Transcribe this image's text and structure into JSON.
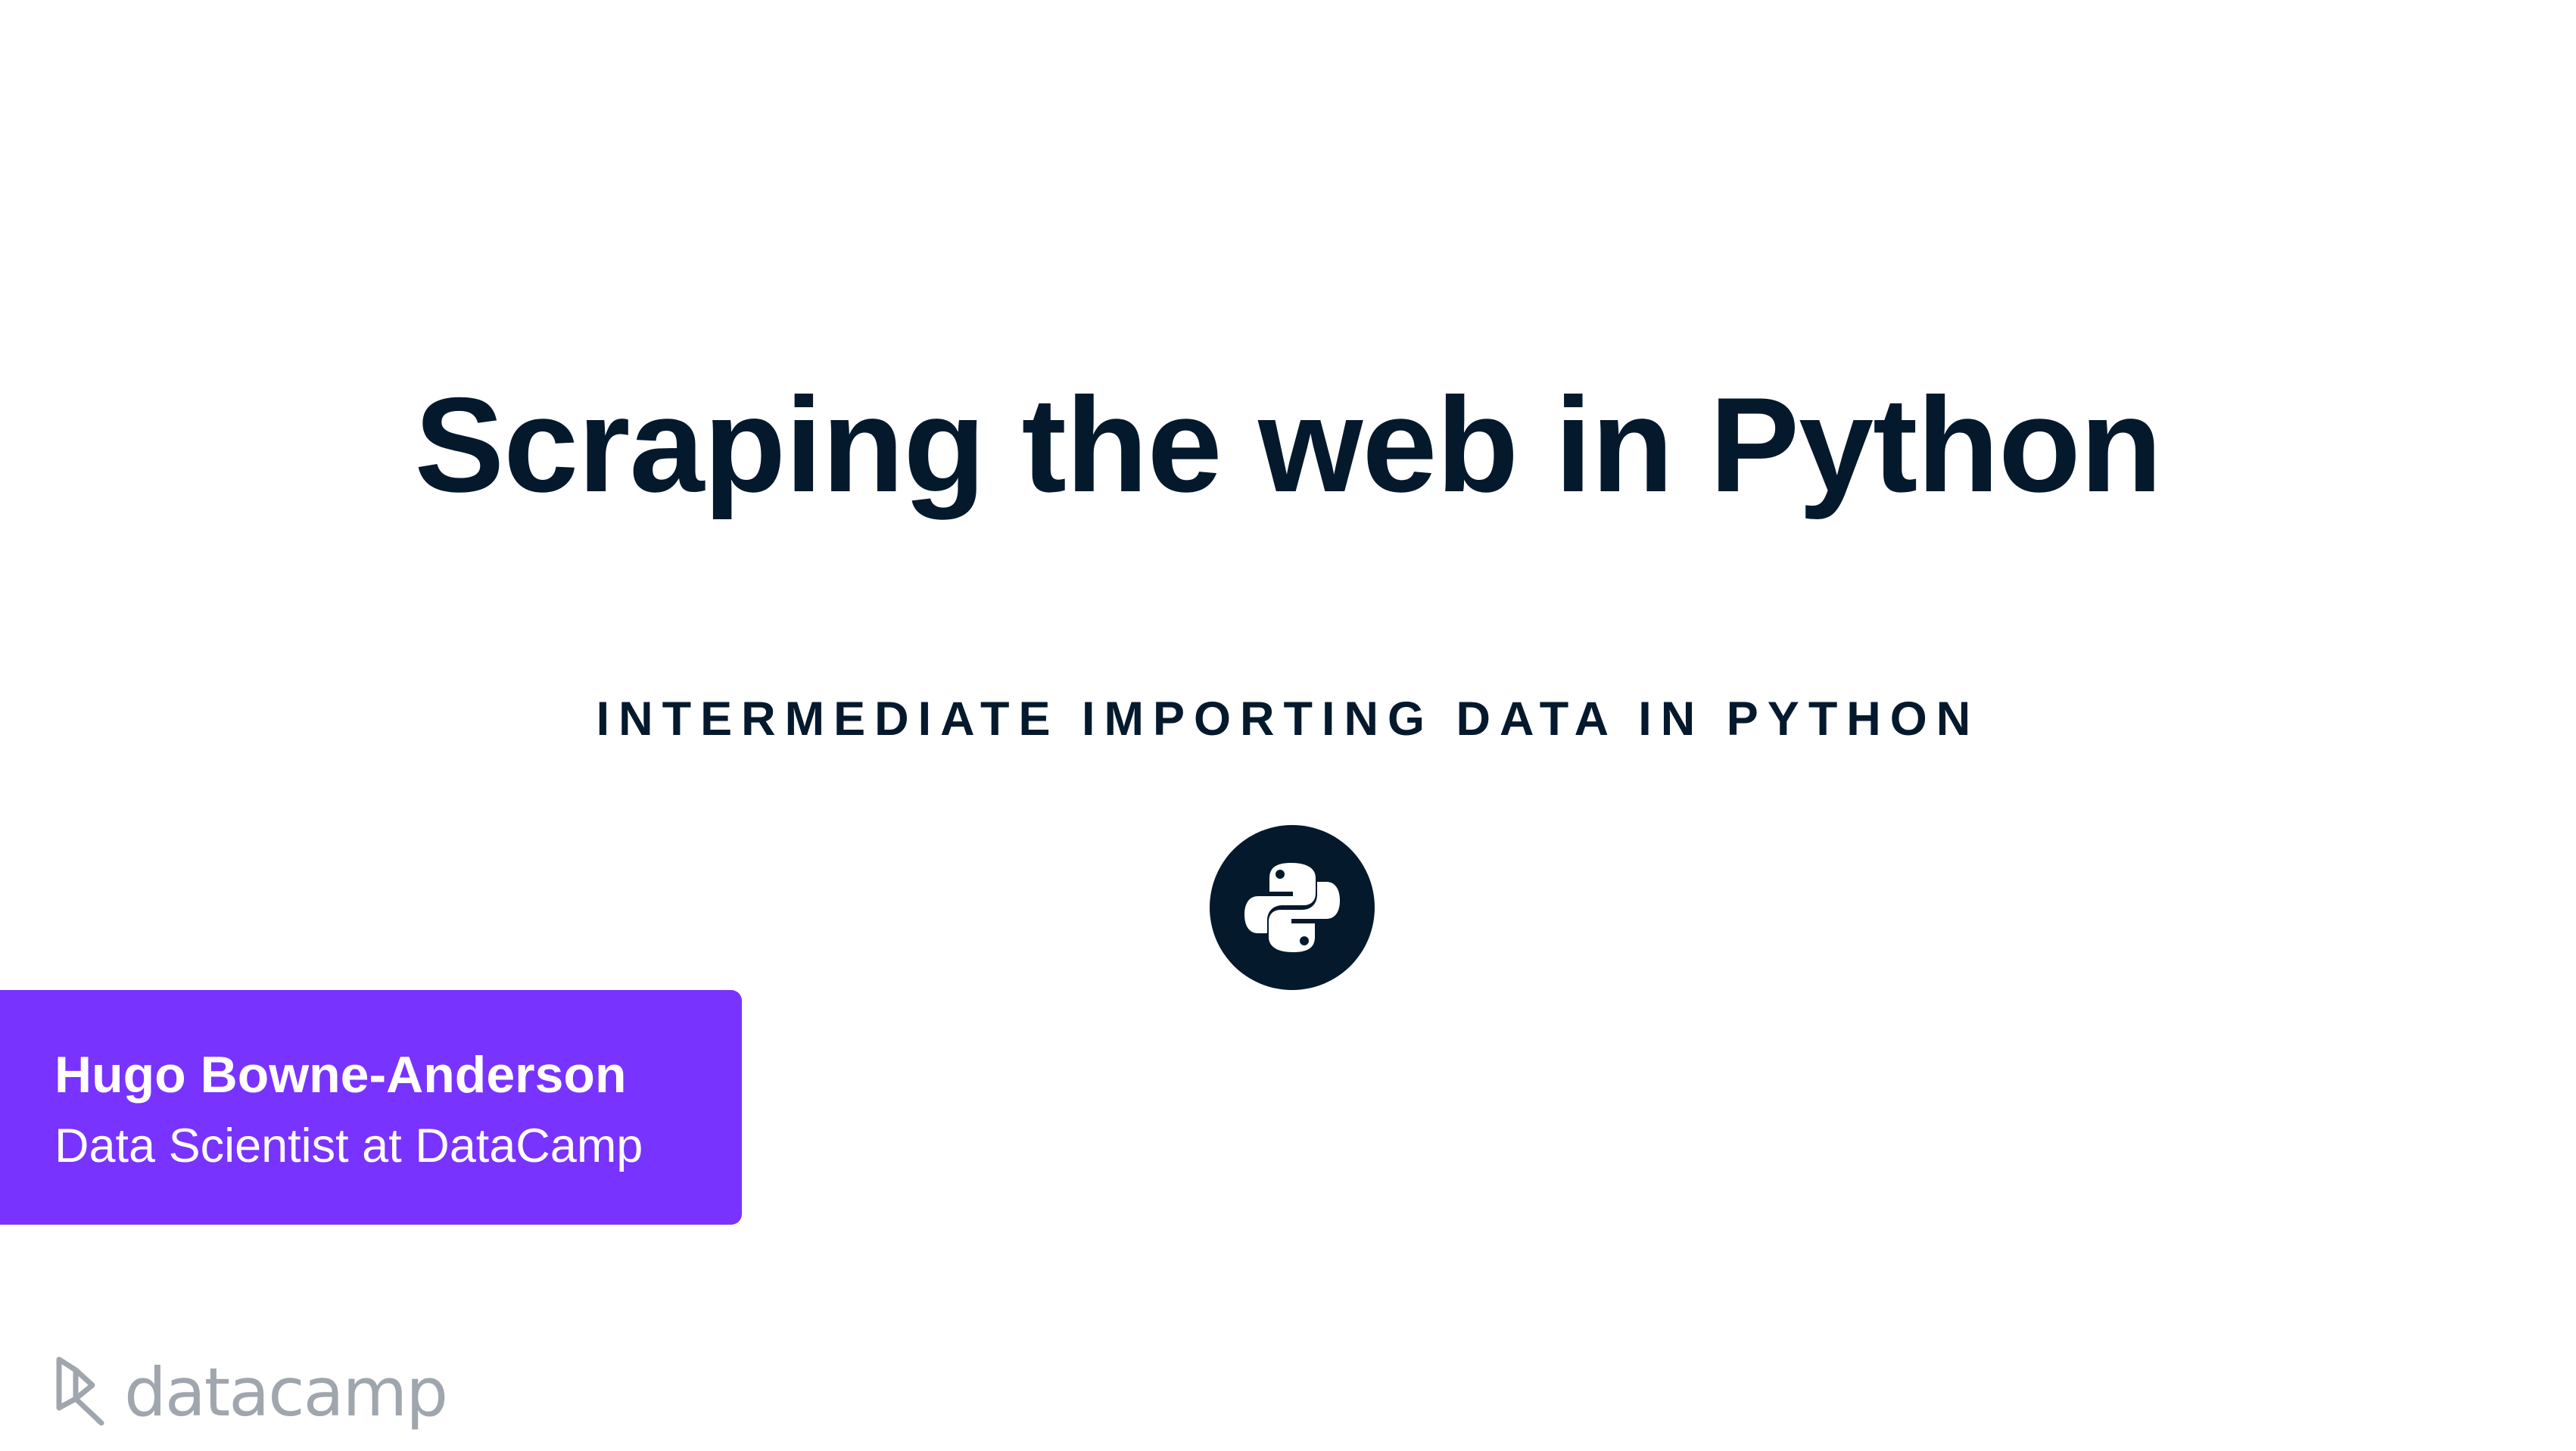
{
  "slide": {
    "title": "Scraping the web in Python",
    "subtitle": "INTERMEDIATE IMPORTING DATA IN PYTHON"
  },
  "badge": {
    "icon": "python-logo-icon"
  },
  "author": {
    "name": "Hugo Bowne-Anderson",
    "role": "Data Scientist at DataCamp"
  },
  "brand": {
    "name": "datacamp",
    "icon": "datacamp-logo-icon"
  },
  "colors": {
    "background": "#ffffff",
    "heading": "#05192d",
    "author_card": "#7933ff",
    "author_text": "#ffffff",
    "brand_text": "#a0a6ad"
  }
}
